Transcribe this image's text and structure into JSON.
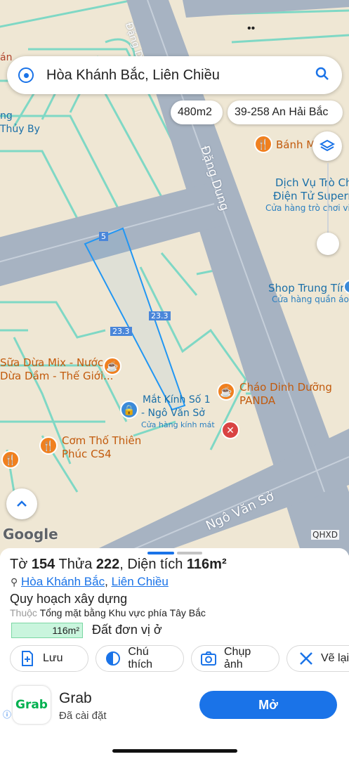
{
  "search": {
    "value": "Hòa Khánh Bắc, Liên Chiều"
  },
  "chips": {
    "area": "480m2",
    "address": "39-258 An Hải Bắc"
  },
  "status": {
    "icons_text": "••"
  },
  "map": {
    "street_labels": [
      "Đặng Dung",
      "Đặng Dung",
      "Ngô Văn Sở"
    ],
    "edge_labels": [
      "5",
      "23.3",
      "23.3"
    ],
    "pois": [
      {
        "name": "Bánh Mì Ph",
        "sub": ""
      },
      {
        "name": "Dịch Vụ Trò Chơ",
        "name2": "Điện Tử Superne",
        "sub": "Cửa hàng trò chơi vide"
      },
      {
        "name": "Shop Trung Tín",
        "sub": "Cửa hàng quần áo"
      },
      {
        "name": "Sữa Dừa Mix - Nước",
        "name2": "Dừa Dầm - Thế Giới...",
        "sub": ""
      },
      {
        "name": "Cháo Dinh Dưỡng",
        "name2": "PANDA",
        "sub": ""
      },
      {
        "name": "Mắt Kính Số 1",
        "name2": "- Ngô Văn Sở",
        "sub": "Cửa hàng kính mát"
      },
      {
        "name": "Cơm Thố Thiên",
        "name2": "Phúc CS4",
        "sub": ""
      }
    ],
    "left_fragments": [
      "án",
      "ng",
      "Thủy By"
    ],
    "google": "Google",
    "qhxd": "QHXD"
  },
  "sheet": {
    "title_prefix": "Tờ",
    "to": "154",
    "thua_label": "Thửa",
    "thua": "222",
    "area_label": "Diện tích",
    "area": "116m²",
    "location_1": "Hòa Khánh Bắc",
    "location_sep": ",",
    "location_2": "Liên Chiều",
    "plan_title": "Quy hoạch xây dựng",
    "belongs_label": "Thuộc",
    "belongs_value": "Tổng mặt bằng Khu vực phía Tây Bắc",
    "zone_area": "116m²",
    "zone_name": "Đất đơn vị ở",
    "actions": [
      "Lưu",
      "Chú thích",
      "Chụp ảnh",
      "Vẽ lại"
    ]
  },
  "ad": {
    "logo": "Grab",
    "title": "Grab",
    "subtitle": "Đã cài đặt",
    "button": "Mở"
  },
  "colors": {
    "accent": "#1a73e8",
    "road": "#aab6c4",
    "parcel_line": "#2196f3",
    "zone_fill": "#c9f5dd"
  }
}
